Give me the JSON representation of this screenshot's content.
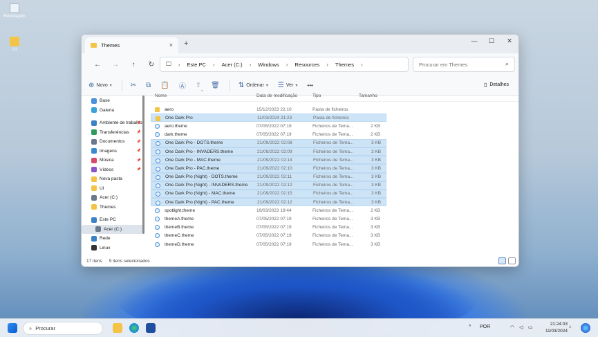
{
  "desktop": {
    "icons": [
      {
        "label": "Reciclagem",
        "icon": "recycle-bin-icon"
      },
      {
        "label": "UI",
        "icon": "folder-icon"
      }
    ]
  },
  "window": {
    "tab_title": "Themes",
    "controls": {
      "minimize": "—",
      "maximize": "☐",
      "close": "✕"
    },
    "address": {
      "segments": [
        "Este PC",
        "Acer (C:)",
        "Windows",
        "Resources",
        "Themes"
      ]
    },
    "search": {
      "placeholder": "Procurar em Themes"
    },
    "toolbar": {
      "new_label": "Novo",
      "sort_label": "Ordenar",
      "view_label": "Ver",
      "more_label": "•••",
      "details_label": "Detalhes"
    },
    "sidebar": {
      "top": [
        {
          "label": "Base",
          "icon": "home-icon",
          "color": "#4a90d9"
        },
        {
          "label": "Galeria",
          "icon": "gallery-icon",
          "color": "#3aa0d8"
        }
      ],
      "quick": [
        {
          "label": "Ambiente de trabalho",
          "icon": "desktop-icon",
          "color": "#3b82c4",
          "pinned": true
        },
        {
          "label": "Transferências",
          "icon": "download-icon",
          "color": "#2e9a5a",
          "pinned": true
        },
        {
          "label": "Documentos",
          "icon": "documents-icon",
          "color": "#6a7a8c",
          "pinned": true
        },
        {
          "label": "Imagens",
          "icon": "pictures-icon",
          "color": "#3a8ad0",
          "pinned": true
        },
        {
          "label": "Música",
          "icon": "music-icon",
          "color": "#d94a6a",
          "pinned": true
        },
        {
          "label": "Vídeos",
          "icon": "videos-icon",
          "color": "#8a55c8",
          "pinned": true
        },
        {
          "label": "Nova pasta",
          "icon": "folder-icon",
          "color": "#f3c446",
          "pinned": false
        },
        {
          "label": "UI",
          "icon": "folder-icon",
          "color": "#f3c446",
          "pinned": false
        },
        {
          "label": "Acer (C:)",
          "icon": "drive-icon",
          "color": "#6a7a8c",
          "pinned": false
        },
        {
          "label": "Themes",
          "icon": "folder-icon",
          "color": "#f3c446",
          "pinned": false
        }
      ],
      "bottom": [
        {
          "label": "Este PC",
          "icon": "pc-icon",
          "color": "#3b82c4",
          "selected": false,
          "sub": false
        },
        {
          "label": "Acer (C:)",
          "icon": "drive-icon",
          "color": "#6a7a8c",
          "selected": true,
          "sub": true
        },
        {
          "label": "Rede",
          "icon": "network-icon",
          "color": "#3b82c4",
          "selected": false,
          "sub": false
        },
        {
          "label": "Linux",
          "icon": "linux-icon",
          "color": "#333333",
          "selected": false,
          "sub": false
        }
      ]
    },
    "columns": [
      "Nome",
      "Data de modificação",
      "Tipo",
      "Tamanho"
    ],
    "files": [
      {
        "name": "aero",
        "date": "15/12/2023 22:10",
        "type": "Pasta de ficheiros",
        "size": "",
        "kind": "folder",
        "selected": false
      },
      {
        "name": "One Dark Pro",
        "date": "11/03/2024 21:23",
        "type": "Pasta de ficheiros",
        "size": "",
        "kind": "folder",
        "selected": true
      },
      {
        "name": "aero.theme",
        "date": "07/05/2022 07:19",
        "type": "Ficheiros de Tema...",
        "size": "2 KB",
        "kind": "theme",
        "selected": false
      },
      {
        "name": "dark.theme",
        "date": "07/05/2022 07:19",
        "type": "Ficheiros de Tema...",
        "size": "2 KB",
        "kind": "theme",
        "selected": false
      },
      {
        "name": "One Dark Pro - DOTS.theme",
        "date": "21/09/2022 02:08",
        "type": "Ficheiros de Tema...",
        "size": "3 KB",
        "kind": "theme",
        "selected": true
      },
      {
        "name": "One Dark Pro - INVADERS.theme",
        "date": "21/09/2022 02:09",
        "type": "Ficheiros de Tema...",
        "size": "3 KB",
        "kind": "theme",
        "selected": true
      },
      {
        "name": "One Dark Pro - MAC.theme",
        "date": "21/09/2022 02:14",
        "type": "Ficheiros de Tema...",
        "size": "3 KB",
        "kind": "theme",
        "selected": true
      },
      {
        "name": "One Dark Pro - PAC.theme",
        "date": "21/09/2022 02:10",
        "type": "Ficheiros de Tema...",
        "size": "3 KB",
        "kind": "theme",
        "selected": true
      },
      {
        "name": "One Dark Pro (Night) - DOTS.theme",
        "date": "21/09/2022 02:11",
        "type": "Ficheiros de Tema...",
        "size": "3 KB",
        "kind": "theme",
        "selected": true
      },
      {
        "name": "One Dark Pro (Night) - INVADERS.theme",
        "date": "21/09/2022 02:12",
        "type": "Ficheiros de Tema...",
        "size": "3 KB",
        "kind": "theme",
        "selected": true
      },
      {
        "name": "One Dark Pro (Night) - MAC.theme",
        "date": "21/09/2022 02:15",
        "type": "Ficheiros de Tema...",
        "size": "3 KB",
        "kind": "theme",
        "selected": true
      },
      {
        "name": "One Dark Pro (Night) - PAC.theme",
        "date": "21/09/2022 02:12",
        "type": "Ficheiros de Tema...",
        "size": "3 KB",
        "kind": "theme",
        "selected": true
      },
      {
        "name": "spotlight.theme",
        "date": "19/03/2023 19:44",
        "type": "Ficheiros de Tema...",
        "size": "2 KB",
        "kind": "theme",
        "selected": false
      },
      {
        "name": "themeA.theme",
        "date": "07/05/2022 07:19",
        "type": "Ficheiros de Tema...",
        "size": "3 KB",
        "kind": "theme",
        "selected": false
      },
      {
        "name": "themeB.theme",
        "date": "07/05/2022 07:19",
        "type": "Ficheiros de Tema...",
        "size": "3 KB",
        "kind": "theme",
        "selected": false
      },
      {
        "name": "themeC.theme",
        "date": "07/05/2022 07:19",
        "type": "Ficheiros de Tema...",
        "size": "3 KB",
        "kind": "theme",
        "selected": false
      },
      {
        "name": "themeD.theme",
        "date": "07/05/2022 07:19",
        "type": "Ficheiros de Tema...",
        "size": "3 KB",
        "kind": "theme",
        "selected": false
      }
    ],
    "status": {
      "count": "17 itens",
      "selected": "9 itens selecionados"
    }
  },
  "taskbar": {
    "search_label": "Procurar",
    "lang": "POR",
    "time": "21:24:03",
    "date": "11/03/2024"
  },
  "colors": {
    "accent": "#0067c0",
    "selection": "#cde4f7"
  }
}
